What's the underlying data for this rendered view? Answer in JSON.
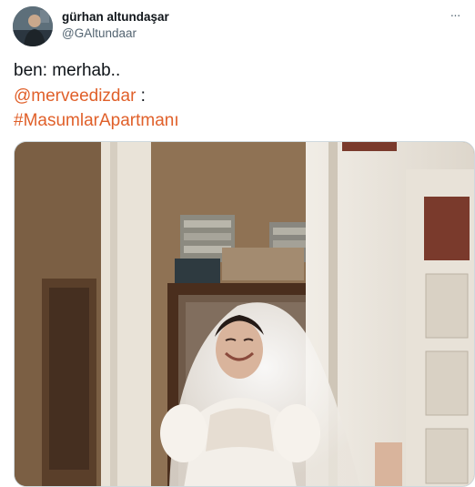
{
  "author": {
    "display_name": "gürhan altundaşar",
    "handle": "@GAltundaar",
    "avatar_icon": "user-avatar"
  },
  "menu": {
    "icon": "more-horizontal-icon",
    "glyph": "···"
  },
  "tweet": {
    "line1": "ben: merhab..",
    "mention": "@merveedizdar",
    "mention_suffix": " :",
    "hashtag": "#MasumlarApartmanı"
  },
  "colors": {
    "link": "#e0602a",
    "text": "#0f1419",
    "secondary": "#536471"
  },
  "media": {
    "description_icon": "photo-media",
    "subject": "bride-in-veil"
  }
}
